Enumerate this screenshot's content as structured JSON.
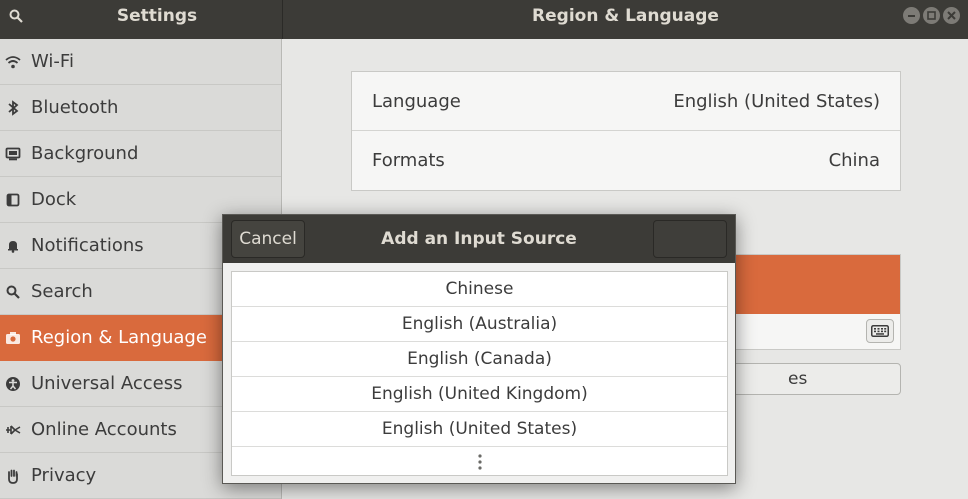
{
  "headerbar": {
    "left_title": "Settings",
    "right_title": "Region & Language",
    "window_buttons": [
      "minimize-icon",
      "maximize-icon",
      "close-icon"
    ]
  },
  "sidebar": {
    "items": [
      {
        "label": "Wi-Fi",
        "icon": "wifi-icon"
      },
      {
        "label": "Bluetooth",
        "icon": "bluetooth-icon"
      },
      {
        "label": "Background",
        "icon": "background-icon"
      },
      {
        "label": "Dock",
        "icon": "dock-icon"
      },
      {
        "label": "Notifications",
        "icon": "bell-icon"
      },
      {
        "label": "Search",
        "icon": "search-icon"
      },
      {
        "label": "Region & Language",
        "icon": "camera-icon",
        "active": true
      },
      {
        "label": "Universal Access",
        "icon": "accessibility-icon"
      },
      {
        "label": "Online Accounts",
        "icon": "online-accounts-icon"
      },
      {
        "label": "Privacy",
        "icon": "hand-icon"
      }
    ]
  },
  "main": {
    "language_label": "Language",
    "language_value": "English (United States)",
    "formats_label": "Formats",
    "formats_value": "China",
    "partial_button_text": "es"
  },
  "dialog": {
    "cancel_label": "Cancel",
    "title": "Add an Input Source",
    "items": [
      "Chinese",
      "English (Australia)",
      "English (Canada)",
      "English (United Kingdom)",
      "English (United States)"
    ]
  },
  "colors": {
    "accent": "#d96a3d",
    "headerbar": "#3c3b37"
  }
}
